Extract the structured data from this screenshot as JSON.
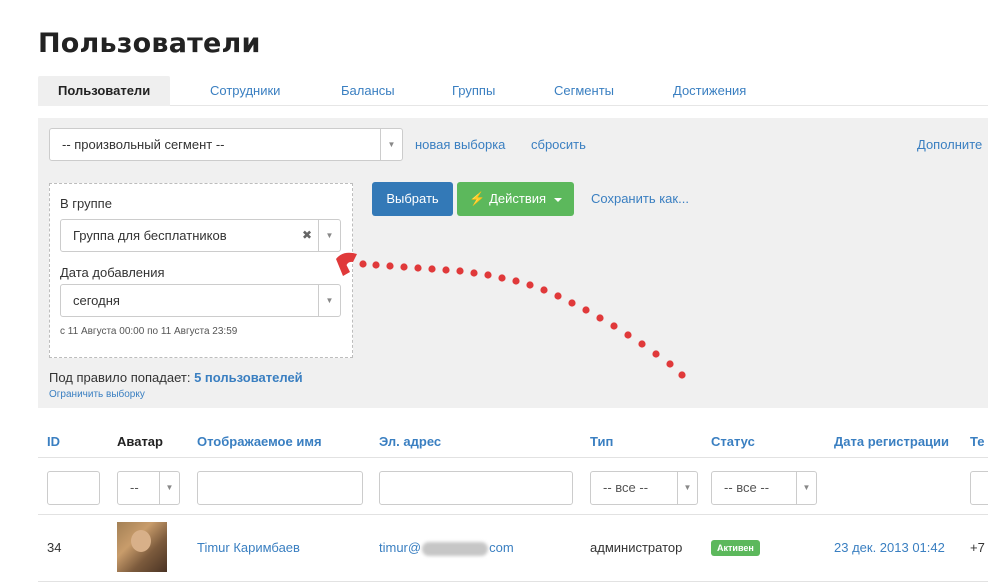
{
  "page": {
    "title": "Пользователи"
  },
  "tabs": [
    {
      "label": "Пользователи"
    },
    {
      "label": "Сотрудники"
    },
    {
      "label": "Балансы"
    },
    {
      "label": "Группы"
    },
    {
      "label": "Сегменты"
    },
    {
      "label": "Достижения"
    }
  ],
  "segment": {
    "selected": "-- произвольный сегмент --",
    "new_link": "новая выборка",
    "reset_link": "сбросить",
    "more_link": "Дополните"
  },
  "filters": {
    "group_label": "В группе",
    "group_value": "Группа для бесплатников",
    "date_label": "Дата добавления",
    "date_value": "сегодня",
    "date_hint": "с 11 Августа 00:00 по 11 Августа 23:59"
  },
  "actions": {
    "select_label": "Выбрать",
    "actions_label": "Действия",
    "save_label": "Сохранить как..."
  },
  "rule": {
    "prefix": "Под правило попадает:",
    "count": "5 пользователей",
    "limit_link": "Ограничить выборку"
  },
  "table": {
    "headers": {
      "id": "ID",
      "avatar": "Аватар",
      "name": "Отображаемое имя",
      "email": "Эл. адрес",
      "type": "Тип",
      "status": "Статус",
      "reg_date": "Дата регистрации",
      "phone": "Те"
    },
    "filters": {
      "avatar": "--",
      "type": "-- все --",
      "status": "-- все --"
    },
    "rows": [
      {
        "id": "34",
        "name": "Timur Каримбаев",
        "email_prefix": "timur@",
        "email_suffix": "com",
        "type": "администратор",
        "status": "Активен",
        "reg_date": "23 дек. 2013 01:42",
        "phone": "+7"
      }
    ]
  },
  "colors": {
    "link": "#3a7fc1",
    "primary": "#3379b7",
    "success": "#5cb85c",
    "annotation": "#e0393a"
  },
  "icons": {
    "actions": "lightning-icon",
    "dropdown": "chevron-down-icon",
    "clear": "close-icon"
  }
}
